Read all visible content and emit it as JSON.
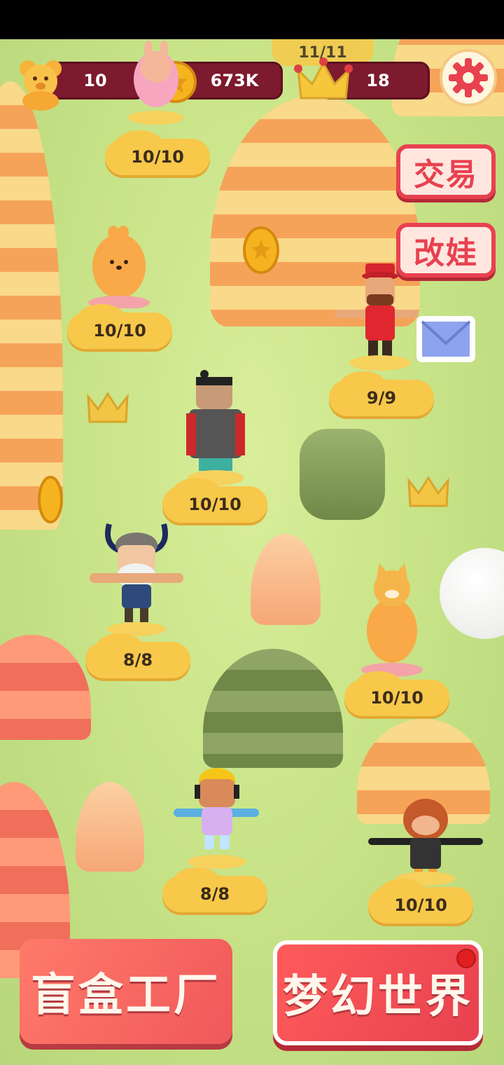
{
  "hud": {
    "bears": "10",
    "coins": "673K",
    "crowns": "18",
    "level_partial": "11/11"
  },
  "side_buttons": {
    "trade": "交易",
    "dress": "改娃"
  },
  "figures": [
    {
      "name": "pink-bunny",
      "progress": "10/10"
    },
    {
      "name": "orange-chick",
      "progress": "10/10"
    },
    {
      "name": "bellhop",
      "progress": "9/9"
    },
    {
      "name": "terracotta-warrior",
      "progress": "10/10"
    },
    {
      "name": "viking",
      "progress": "8/8"
    },
    {
      "name": "yellow-cat",
      "progress": "10/10"
    },
    {
      "name": "construction-worker",
      "progress": "8/8"
    },
    {
      "name": "monkey",
      "progress": "10/10"
    }
  ],
  "bottom": {
    "left_label": "盲盒工厂",
    "right_label": "梦幻世界"
  },
  "colors": {
    "hud_bg": "#7d1a2e",
    "accent_red": "#e8414f",
    "label_yellow": "#f7c84a",
    "grass": "#c9e489"
  }
}
